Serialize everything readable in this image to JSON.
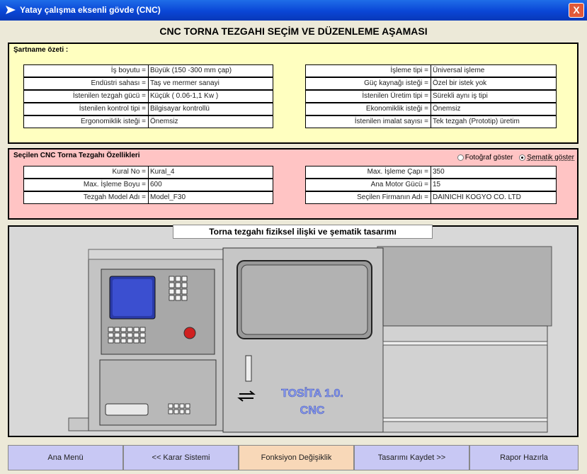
{
  "window": {
    "title": "Yatay çalışma eksenli gövde (CNC)",
    "close_glyph": "X"
  },
  "heading": "CNC TORNA TEZGAHI SEÇİM VE DÜZENLEME AŞAMASI",
  "spec": {
    "title": "Şartname özeti :",
    "left": [
      {
        "label": "İş boyutu =",
        "value": "Büyük (150 -300 mm çap)"
      },
      {
        "label": "Endüstri sahası =",
        "value": "Taş ve mermer sanayi"
      },
      {
        "label": "İstenilen tezgah gücü =",
        "value": "Küçük ( 0.06-1,1 Kw )"
      },
      {
        "label": "İstenilen kontrol tipi =",
        "value": "Bilgisayar kontrollü"
      },
      {
        "label": "Ergonomiklik isteği =",
        "value": "Önemsiz"
      }
    ],
    "right": [
      {
        "label": "İşleme tipi =",
        "value": "Üniversal işleme"
      },
      {
        "label": "Güç kaynağı isteği =",
        "value": "Özel bir istek yok"
      },
      {
        "label": "İstenilen Üretim tipi =",
        "value": "Sürekli aynı iş tipi"
      },
      {
        "label": "Ekonomiklik isteği =",
        "value": "Önemsiz"
      },
      {
        "label": "İstenilen imalat sayısı =",
        "value": "Tek tezgah (Prototip) üretim"
      }
    ]
  },
  "selected": {
    "title": "Seçilen CNC Torna Tezgahı Özellikleri",
    "radio_photo": "Fotoğraf göster",
    "radio_schema": "Şematik göster",
    "left": [
      {
        "label": "Kural No =",
        "value": "Kural_4"
      },
      {
        "label": "Max. İşleme Boyu =",
        "value": "600"
      },
      {
        "label": "Tezgah Model Adı =",
        "value": "Model_F30"
      }
    ],
    "right": [
      {
        "label": "Max. İşleme Çapı =",
        "value": "350"
      },
      {
        "label": "Ana Motor Gücü =",
        "value": "15"
      },
      {
        "label": "Seçilen Firmanın Adı =",
        "value": "DAINICHI KOGYO CO. LTD"
      }
    ]
  },
  "drawing": {
    "title": "Torna tezgahı fiziksel ilişki ve şematik  tasarımı",
    "brand_line1": "TOSİTA 1.0.",
    "brand_line2": "CNC"
  },
  "nav": [
    "Ana Menü",
    "<< Karar Sistemi",
    "Fonksiyon Değişiklik",
    "Tasarımı Kaydet >>",
    "Rapor Hazırla"
  ]
}
